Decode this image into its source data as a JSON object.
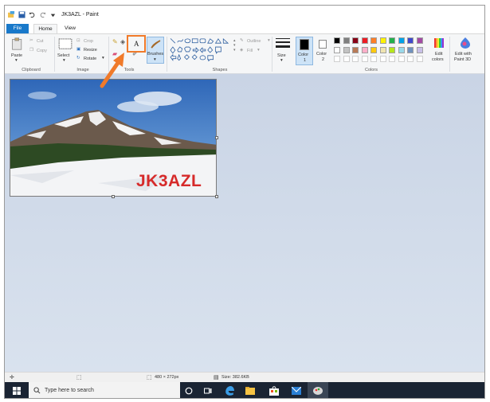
{
  "window": {
    "title": "JK3AZL - Paint"
  },
  "tabs": [
    {
      "label": "File"
    },
    {
      "label": "Home"
    },
    {
      "label": "View"
    }
  ],
  "ribbon": {
    "clipboard": {
      "paste": "Paste",
      "cut": "Cut",
      "copy": "Copy",
      "group": "Clipboard"
    },
    "image": {
      "select": "Select",
      "crop": "Crop",
      "resize": "Resize",
      "rotate": "Rotate",
      "group": "Image"
    },
    "tools": {
      "group": "Tools",
      "text_glyph": "A"
    },
    "brushes": {
      "label": "Brushes"
    },
    "shapes": {
      "outline": "Outline",
      "fill": "Fill",
      "group": "Shapes"
    },
    "size": {
      "label": "Size"
    },
    "color1": {
      "label": "Color",
      "sub": "1"
    },
    "color2": {
      "label": "Color",
      "sub": "2"
    },
    "colors": {
      "group": "Colors",
      "edit_label": "Edit",
      "edit_sub": "colors"
    },
    "paint3d": {
      "label": "Edit with",
      "sub": "Paint 3D"
    }
  },
  "palette": [
    "#000000",
    "#7f7f7f",
    "#880015",
    "#ed1c24",
    "#ff7f27",
    "#fff200",
    "#22b14c",
    "#00a2e8",
    "#3f48cc",
    "#a349a4",
    "#ffffff",
    "#c3c3c3",
    "#b97a57",
    "#ffaec9",
    "#ffc90e",
    "#efe4b0",
    "#b5e61d",
    "#99d9ea",
    "#7092be",
    "#c8bfe7"
  ],
  "canvas": {
    "overlay_text": "JK3AZL"
  },
  "status": {
    "dimensions": "480 × 272px",
    "size": "Size: 382.6KB"
  },
  "taskbar": {
    "search_placeholder": "Type here to search"
  },
  "colors": {
    "accent": "#1979ca",
    "annotation": "#f07a2a",
    "overlay_text": "#d62a2a"
  }
}
